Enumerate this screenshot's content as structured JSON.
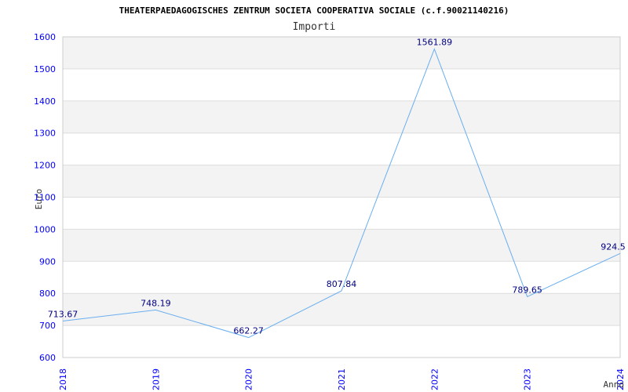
{
  "chart_data": {
    "type": "line",
    "title": "THEATERPAEDAGOGISCHES ZENTRUM SOCIETA COOPERATIVA SOCIALE (c.f.90021140216)",
    "subtitle": "Importi",
    "xlabel": "Anno",
    "ylabel": "Euro",
    "categories": [
      "2018",
      "2019",
      "2020",
      "2021",
      "2022",
      "2023",
      "2024"
    ],
    "values": [
      713.67,
      748.19,
      662.27,
      807.84,
      1561.89,
      789.65,
      924.5
    ],
    "value_labels": [
      "713.67",
      "748.19",
      "662.27",
      "807.84",
      "1561.89",
      "789.65",
      "924.5"
    ],
    "yticks": [
      "600",
      "700",
      "800",
      "900",
      "1000",
      "1100",
      "1200",
      "1300",
      "1400",
      "1500",
      "1600"
    ],
    "ylim": [
      600,
      1600
    ],
    "grid": true,
    "colors": {
      "line": "#6aaef0",
      "tick_labels": "#0000ff",
      "value_labels": "#000080",
      "band": "#f3f3f3",
      "grid": "#dddddd"
    }
  }
}
